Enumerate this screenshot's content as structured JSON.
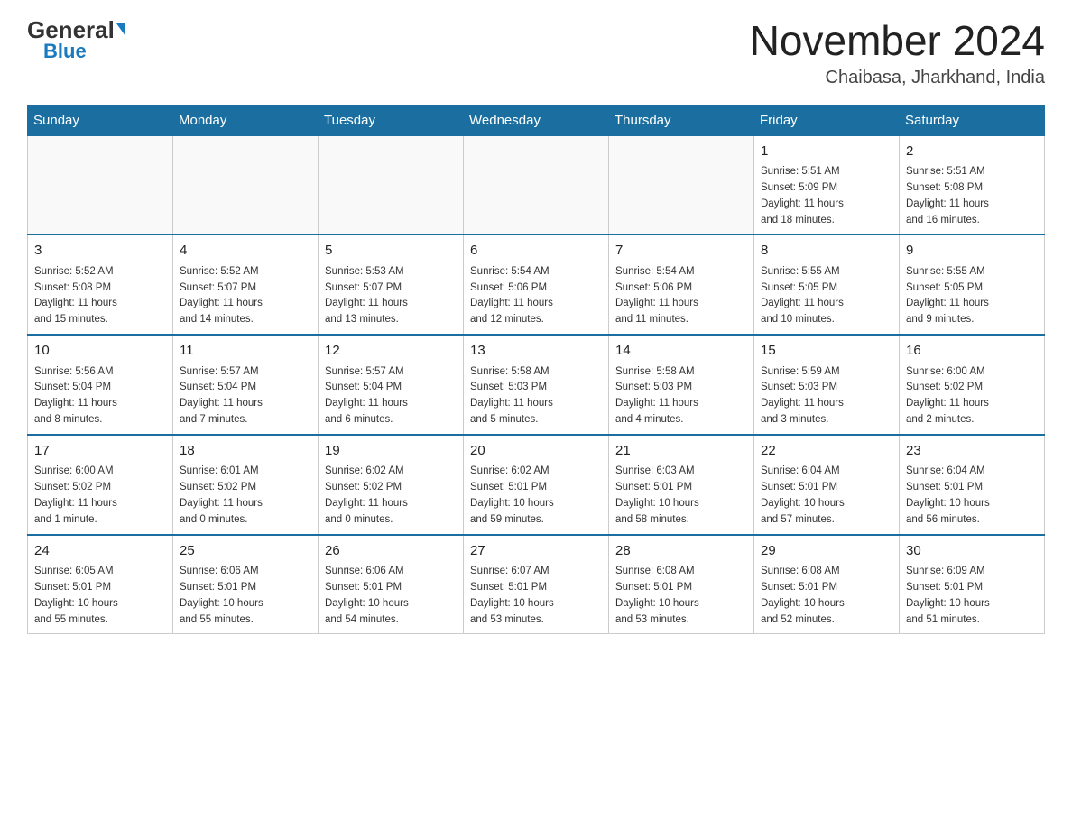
{
  "logo": {
    "general": "General",
    "blue": "Blue"
  },
  "header": {
    "title": "November 2024",
    "subtitle": "Chaibasa, Jharkhand, India"
  },
  "weekdays": [
    "Sunday",
    "Monday",
    "Tuesday",
    "Wednesday",
    "Thursday",
    "Friday",
    "Saturday"
  ],
  "weeks": [
    [
      {
        "day": "",
        "info": ""
      },
      {
        "day": "",
        "info": ""
      },
      {
        "day": "",
        "info": ""
      },
      {
        "day": "",
        "info": ""
      },
      {
        "day": "",
        "info": ""
      },
      {
        "day": "1",
        "info": "Sunrise: 5:51 AM\nSunset: 5:09 PM\nDaylight: 11 hours\nand 18 minutes."
      },
      {
        "day": "2",
        "info": "Sunrise: 5:51 AM\nSunset: 5:08 PM\nDaylight: 11 hours\nand 16 minutes."
      }
    ],
    [
      {
        "day": "3",
        "info": "Sunrise: 5:52 AM\nSunset: 5:08 PM\nDaylight: 11 hours\nand 15 minutes."
      },
      {
        "day": "4",
        "info": "Sunrise: 5:52 AM\nSunset: 5:07 PM\nDaylight: 11 hours\nand 14 minutes."
      },
      {
        "day": "5",
        "info": "Sunrise: 5:53 AM\nSunset: 5:07 PM\nDaylight: 11 hours\nand 13 minutes."
      },
      {
        "day": "6",
        "info": "Sunrise: 5:54 AM\nSunset: 5:06 PM\nDaylight: 11 hours\nand 12 minutes."
      },
      {
        "day": "7",
        "info": "Sunrise: 5:54 AM\nSunset: 5:06 PM\nDaylight: 11 hours\nand 11 minutes."
      },
      {
        "day": "8",
        "info": "Sunrise: 5:55 AM\nSunset: 5:05 PM\nDaylight: 11 hours\nand 10 minutes."
      },
      {
        "day": "9",
        "info": "Sunrise: 5:55 AM\nSunset: 5:05 PM\nDaylight: 11 hours\nand 9 minutes."
      }
    ],
    [
      {
        "day": "10",
        "info": "Sunrise: 5:56 AM\nSunset: 5:04 PM\nDaylight: 11 hours\nand 8 minutes."
      },
      {
        "day": "11",
        "info": "Sunrise: 5:57 AM\nSunset: 5:04 PM\nDaylight: 11 hours\nand 7 minutes."
      },
      {
        "day": "12",
        "info": "Sunrise: 5:57 AM\nSunset: 5:04 PM\nDaylight: 11 hours\nand 6 minutes."
      },
      {
        "day": "13",
        "info": "Sunrise: 5:58 AM\nSunset: 5:03 PM\nDaylight: 11 hours\nand 5 minutes."
      },
      {
        "day": "14",
        "info": "Sunrise: 5:58 AM\nSunset: 5:03 PM\nDaylight: 11 hours\nand 4 minutes."
      },
      {
        "day": "15",
        "info": "Sunrise: 5:59 AM\nSunset: 5:03 PM\nDaylight: 11 hours\nand 3 minutes."
      },
      {
        "day": "16",
        "info": "Sunrise: 6:00 AM\nSunset: 5:02 PM\nDaylight: 11 hours\nand 2 minutes."
      }
    ],
    [
      {
        "day": "17",
        "info": "Sunrise: 6:00 AM\nSunset: 5:02 PM\nDaylight: 11 hours\nand 1 minute."
      },
      {
        "day": "18",
        "info": "Sunrise: 6:01 AM\nSunset: 5:02 PM\nDaylight: 11 hours\nand 0 minutes."
      },
      {
        "day": "19",
        "info": "Sunrise: 6:02 AM\nSunset: 5:02 PM\nDaylight: 11 hours\nand 0 minutes."
      },
      {
        "day": "20",
        "info": "Sunrise: 6:02 AM\nSunset: 5:01 PM\nDaylight: 10 hours\nand 59 minutes."
      },
      {
        "day": "21",
        "info": "Sunrise: 6:03 AM\nSunset: 5:01 PM\nDaylight: 10 hours\nand 58 minutes."
      },
      {
        "day": "22",
        "info": "Sunrise: 6:04 AM\nSunset: 5:01 PM\nDaylight: 10 hours\nand 57 minutes."
      },
      {
        "day": "23",
        "info": "Sunrise: 6:04 AM\nSunset: 5:01 PM\nDaylight: 10 hours\nand 56 minutes."
      }
    ],
    [
      {
        "day": "24",
        "info": "Sunrise: 6:05 AM\nSunset: 5:01 PM\nDaylight: 10 hours\nand 55 minutes."
      },
      {
        "day": "25",
        "info": "Sunrise: 6:06 AM\nSunset: 5:01 PM\nDaylight: 10 hours\nand 55 minutes."
      },
      {
        "day": "26",
        "info": "Sunrise: 6:06 AM\nSunset: 5:01 PM\nDaylight: 10 hours\nand 54 minutes."
      },
      {
        "day": "27",
        "info": "Sunrise: 6:07 AM\nSunset: 5:01 PM\nDaylight: 10 hours\nand 53 minutes."
      },
      {
        "day": "28",
        "info": "Sunrise: 6:08 AM\nSunset: 5:01 PM\nDaylight: 10 hours\nand 53 minutes."
      },
      {
        "day": "29",
        "info": "Sunrise: 6:08 AM\nSunset: 5:01 PM\nDaylight: 10 hours\nand 52 minutes."
      },
      {
        "day": "30",
        "info": "Sunrise: 6:09 AM\nSunset: 5:01 PM\nDaylight: 10 hours\nand 51 minutes."
      }
    ]
  ]
}
